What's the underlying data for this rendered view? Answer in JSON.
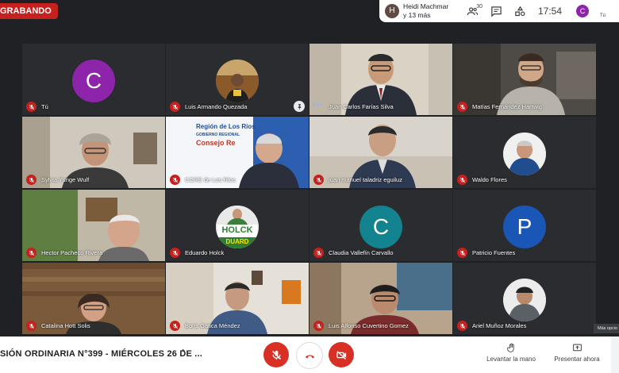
{
  "recording": {
    "label": "GRABANDO"
  },
  "header": {
    "host_initial": "H",
    "host_line1": "Heidi Machmar",
    "host_line2": "y 13 más",
    "people_count": "30",
    "time": "17:54",
    "me_initial": "C",
    "me_label": "Tú",
    "icons": [
      "people-icon",
      "chat-icon",
      "activities-icon"
    ]
  },
  "participants": [
    {
      "name": "Tú",
      "avatar": "C",
      "avatar_color": "#8e24aa"
    },
    {
      "name": "Luis Armando Quezada",
      "avatar_type": "photo"
    },
    {
      "name": "Juan Carlos Farías Silva",
      "video": true,
      "speaking": true
    },
    {
      "name": "Matías Fernández Hartwig",
      "video": true
    },
    {
      "name": "Sylvia Yunge Wulf",
      "video": true
    },
    {
      "name": "CORE de Los Ríos",
      "video": true,
      "banner_line1": "Región de Los Ríos",
      "banner_line2": "GOBIERNO REGIONAL",
      "banner_line3": "Consejo Re"
    },
    {
      "name": "juan manuel taladriz eguiluz",
      "video": true
    },
    {
      "name": "Waldo Flores",
      "avatar_type": "photo"
    },
    {
      "name": "Hector Pacheco Rivera",
      "video": true
    },
    {
      "name": "Eduardo Holck",
      "avatar_type": "photo",
      "avatar_text1": "HOLCK",
      "avatar_text2": "DUARD"
    },
    {
      "name": "Claudia Vallefín Carvallo",
      "avatar": "C",
      "avatar_color": "#12838f"
    },
    {
      "name": "Patricio Fuentes",
      "avatar": "P",
      "avatar_color": "#1a56b6"
    },
    {
      "name": "Catalina Hott Solis",
      "video": true
    },
    {
      "name": "Boris Gatica Méndez",
      "video": true
    },
    {
      "name": "Luis Alfonso Cuvertino Gomez",
      "video": true
    },
    {
      "name": "Ariel Muñoz Morales",
      "avatar_type": "photo"
    }
  ],
  "bottom_bar": {
    "meeting_title": "SIÓN ORDINARIA N°399 - MIÉRCOLES 26 DE ...",
    "raise_hand": "Levantar la mano",
    "present": "Presentar ahora"
  },
  "more_options": "Más opcio",
  "colors": {
    "background": "#202124",
    "danger": "#d93025",
    "recording": "#c5221f"
  }
}
